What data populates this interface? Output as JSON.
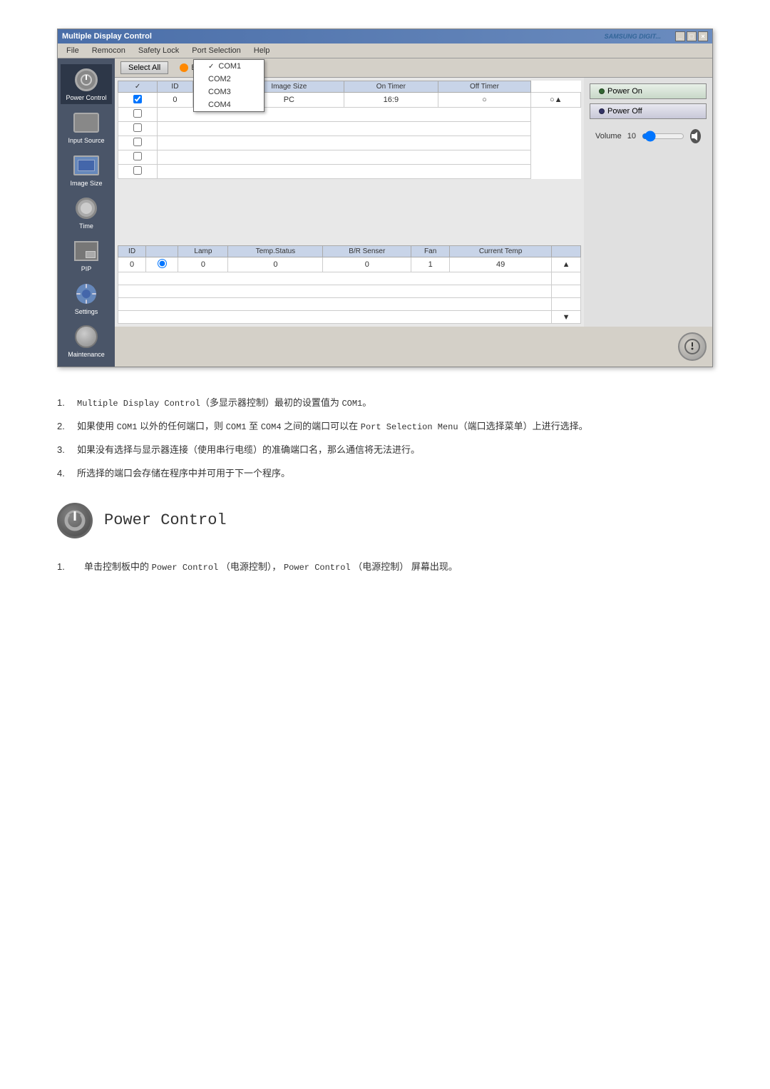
{
  "window": {
    "title": "Multiple Display Control",
    "samsung_logo": "SAMSUNG DIGIT...",
    "title_buttons": [
      "_",
      "□",
      "×"
    ]
  },
  "menu": {
    "items": [
      "File",
      "Remocon",
      "Safety Lock",
      "Port Selection",
      "Help"
    ],
    "dropdown": {
      "visible": true,
      "items": [
        "COM1",
        "COM2",
        "COM3",
        "COM4"
      ],
      "selected": "COM1"
    }
  },
  "sidebar": {
    "items": [
      {
        "label": "Power Control",
        "active": true
      },
      {
        "label": "Input Source"
      },
      {
        "label": "Image Size"
      },
      {
        "label": "Time"
      },
      {
        "label": "PIP"
      },
      {
        "label": "Settings"
      },
      {
        "label": "Maintenance"
      }
    ]
  },
  "topbar": {
    "select_all": "Select All",
    "busy_label": "Busy"
  },
  "main_table": {
    "headers": [
      "",
      "ID",
      "",
      "Image Size",
      "On Timer",
      "Off Timer"
    ],
    "row": [
      "checked",
      "0",
      "radio",
      "PC",
      "16:9",
      "radio_empty",
      "radio_up"
    ]
  },
  "power_controls": {
    "power_on": "Power On",
    "power_off": "Power Off"
  },
  "volume": {
    "label": "Volume",
    "value": "10"
  },
  "lower_table": {
    "headers": [
      "ID",
      "",
      "Lamp",
      "Temp.Status",
      "B/R Senser",
      "Fan",
      "Current Temp"
    ],
    "row": [
      "0",
      "radio_on",
      "0",
      "0",
      "0",
      "1",
      "49"
    ]
  },
  "instructions": [
    {
      "number": "1.",
      "text": "Multiple Display Control（多显示器控制）最初的设置值为 COM1。"
    },
    {
      "number": "2.",
      "text": "如果使用 COM1 以外的任何端口，则 COM1 至 COM4 之间的端口可以在 Port Selection Menu（端口选择菜单）上进行选择。"
    },
    {
      "number": "3.",
      "text": "如果没有选择与显示器连接（使用串行电缆）的准确端口名，那么通信将无法进行。"
    },
    {
      "number": "4.",
      "text": "所选择的端口会存储在程序中并可用于下一个程序。"
    }
  ],
  "power_control_section": {
    "title": "Power Control",
    "sub_instructions": [
      {
        "number": "1.",
        "text": "单击控制板中的 Power Control （电源控制）， Power Control （电源控制） 屏幕出现。"
      }
    ]
  }
}
